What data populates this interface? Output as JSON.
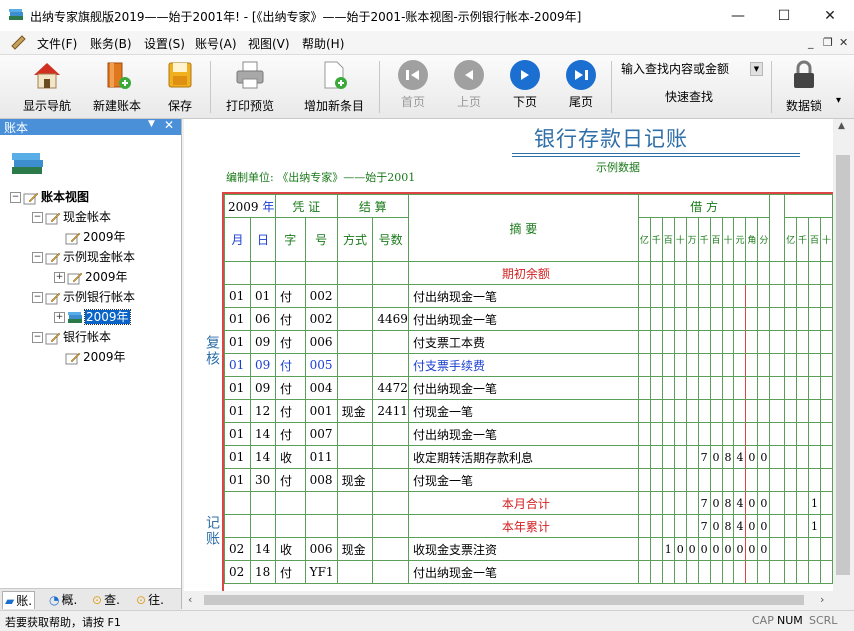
{
  "window": {
    "title": "出纳专家旗舰版2019——始于2001年!  - [《出纳专家》——始于2001-账本视图-示例银行帐本-2009年]",
    "minimize": "—",
    "maximize": "☐",
    "close": "✕"
  },
  "menu": {
    "items": [
      "文件(F)",
      "账务(B)",
      "设置(S)",
      "账号(A)",
      "视图(V)",
      "帮助(H)"
    ],
    "mdi_min": "_",
    "mdi_restore": "❐",
    "mdi_close": "✕"
  },
  "toolbar": {
    "nav": "显示导航",
    "new_book": "新建账本",
    "save": "保存",
    "print_preview": "打印预览",
    "add_entry": "增加新条目",
    "first": "首页",
    "prev": "上页",
    "next": "下页",
    "last": "尾页",
    "search_placeholder": "输入查找内容或金额",
    "quick_search": "快速查找",
    "data_lock": "数据锁"
  },
  "left_panel": {
    "title": "账本",
    "tree": [
      {
        "label": "账本视图",
        "level": 0,
        "exp": "−"
      },
      {
        "label": "现金帐本",
        "level": 1,
        "exp": "−"
      },
      {
        "label": "2009年",
        "level": 2,
        "exp": ""
      },
      {
        "label": "示例现金帐本",
        "level": 1,
        "exp": "−"
      },
      {
        "label": "2009年",
        "level": 2,
        "exp": "+"
      },
      {
        "label": "示例银行帐本",
        "level": 1,
        "exp": "−"
      },
      {
        "label": "2009年",
        "level": 2,
        "exp": "+",
        "selected": true
      },
      {
        "label": "银行帐本",
        "level": 1,
        "exp": "−"
      },
      {
        "label": "2009年",
        "level": 2,
        "exp": ""
      }
    ],
    "tabs": [
      "账.",
      "概.",
      "查.",
      "往."
    ]
  },
  "ledger": {
    "title": "银行存款日记账",
    "subtitle": "示例数据",
    "unit": "编制单位: 《出纳专家》——始于2001",
    "side_label_1": "复核",
    "side_label_2": "记账",
    "header": {
      "year": "2009",
      "year_unit": "年",
      "voucher": "凭 证",
      "settle": "结 算",
      "summary": "摘  要",
      "debit": "借 方",
      "month": "月",
      "day": "日",
      "word": "字",
      "number": "号",
      "method": "方式",
      "no": "号数",
      "digits": [
        "亿",
        "千",
        "百",
        "十",
        "万",
        "千",
        "百",
        "十",
        "元",
        "角",
        "分"
      ],
      "digits2": [
        "亿",
        "千",
        "百",
        "十"
      ]
    },
    "opening": "期初余额",
    "rows": [
      {
        "m": "01",
        "d": "01",
        "w": "付",
        "n": "002",
        "method": "",
        "no": "",
        "summary": "付出纳现金一笔",
        "amount": "",
        "color": ""
      },
      {
        "m": "01",
        "d": "06",
        "w": "付",
        "n": "002",
        "method": "",
        "no": "4469",
        "summary": "付出纳现金一笔",
        "amount": "",
        "color": ""
      },
      {
        "m": "01",
        "d": "09",
        "w": "付",
        "n": "006",
        "method": "",
        "no": "",
        "summary": "付支票工本费",
        "amount": "",
        "color": ""
      },
      {
        "m": "01",
        "d": "09",
        "w": "付",
        "n": "005",
        "method": "",
        "no": "",
        "summary": "付支票手续费",
        "amount": "",
        "color": "blue"
      },
      {
        "m": "01",
        "d": "09",
        "w": "付",
        "n": "004",
        "method": "",
        "no": "4472",
        "summary": "付出纳现金一笔",
        "amount": "",
        "color": ""
      },
      {
        "m": "01",
        "d": "12",
        "w": "付",
        "n": "001",
        "method": "现金",
        "no": "2411",
        "summary": "付现金一笔",
        "amount": "",
        "color": ""
      },
      {
        "m": "01",
        "d": "14",
        "w": "付",
        "n": "007",
        "method": "",
        "no": "",
        "summary": "付出纳现金一笔",
        "amount": "",
        "color": ""
      },
      {
        "m": "01",
        "d": "14",
        "w": "收",
        "n": "011",
        "method": "",
        "no": "",
        "summary": "收定期转活期存款利息",
        "amount": "708400",
        "color": ""
      },
      {
        "m": "01",
        "d": "30",
        "w": "付",
        "n": "008",
        "method": "现金",
        "no": "",
        "summary": "付现金一笔",
        "amount": "",
        "color": ""
      },
      {
        "m": "",
        "d": "",
        "w": "",
        "n": "",
        "method": "",
        "no": "",
        "summary": "本月合计",
        "amount": "708400",
        "color": "red",
        "extra": "1"
      },
      {
        "m": "",
        "d": "",
        "w": "",
        "n": "",
        "method": "",
        "no": "",
        "summary": "本年累计",
        "amount": "708400",
        "color": "red",
        "extra": "1"
      },
      {
        "m": "02",
        "d": "14",
        "w": "收",
        "n": "006",
        "method": "现金",
        "no": "",
        "summary": "收现金支票注资",
        "amount": "100000000",
        "color": ""
      },
      {
        "m": "02",
        "d": "18",
        "w": "付",
        "n": "YF1",
        "method": "",
        "no": "",
        "summary": "付出纳现金一笔",
        "amount": "",
        "color": ""
      }
    ]
  },
  "statusbar": {
    "help": "若要获取帮助，请按 F1",
    "cap": "CAP",
    "num": "NUM",
    "scrl": "SCRL"
  }
}
